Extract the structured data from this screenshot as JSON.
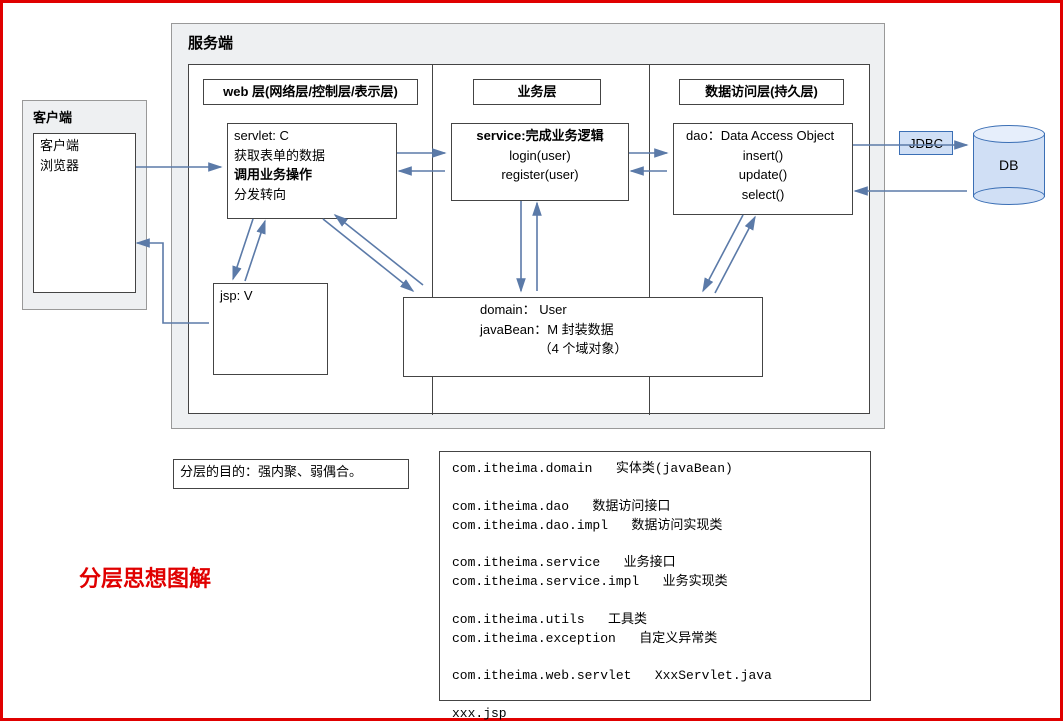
{
  "client": {
    "title": "客户端",
    "lines": [
      "客户端",
      "浏览器"
    ]
  },
  "server": {
    "title": "服务端",
    "web_layer": {
      "title": "web 层(网络层/控制层/表示层)",
      "servlet": [
        "servlet: C",
        "  获取表单的数据",
        "  调用业务操作",
        "  分发转向"
      ],
      "jsp": "jsp: V"
    },
    "service_layer": {
      "title": "业务层",
      "service": [
        "service:完成业务逻辑",
        "login(user)",
        "register(user)"
      ]
    },
    "dao_layer": {
      "title": "数据访问层(持久层)",
      "dao": [
        "dao：Data Access Object",
        "insert()",
        "update()",
        "select()"
      ]
    },
    "domain": [
      "domain： User",
      "javaBean：M 封装数据",
      "（4 个域对象）"
    ]
  },
  "jdbc": "JDBC",
  "db": "DB",
  "purpose": "分层的目的：强内聚、弱偶合。",
  "big_title": "分层思想图解",
  "packages": "com.itheima.domain   实体类(javaBean)\n\ncom.itheima.dao   数据访问接口\ncom.itheima.dao.impl   数据访问实现类\n\ncom.itheima.service   业务接口\ncom.itheima.service.impl   业务实现类\n\ncom.itheima.utils   工具类\ncom.itheima.exception   自定义异常类\n\ncom.itheima.web.servlet   XxxServlet.java\n\nxxx.jsp"
}
